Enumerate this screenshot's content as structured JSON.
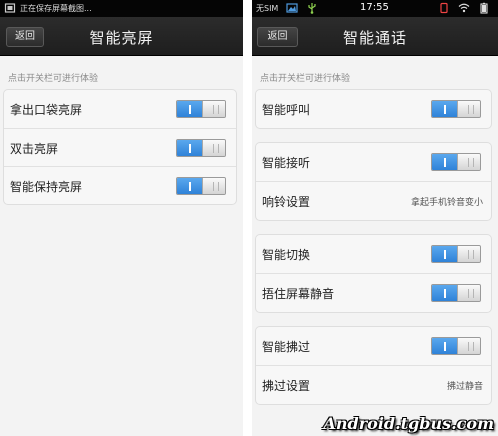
{
  "left": {
    "status": {
      "notification": "正在保存屏幕截图..."
    },
    "header": {
      "back_label": "返回",
      "title": "智能亮屏"
    },
    "hint": "点击开关栏可进行体验",
    "items": [
      {
        "label": "拿出口袋亮屏",
        "enabled": true
      },
      {
        "label": "双击亮屏",
        "enabled": true
      },
      {
        "label": "智能保持亮屏",
        "enabled": true
      }
    ]
  },
  "right": {
    "status": {
      "carrier": "无SIM",
      "time": "17:55"
    },
    "header": {
      "back_label": "返回",
      "title": "智能通话"
    },
    "hint": "点击开关栏可进行体验",
    "groups": [
      {
        "rows": [
          {
            "label": "智能呼叫",
            "enabled": true
          }
        ]
      },
      {
        "rows": [
          {
            "label": "智能接听",
            "enabled": true
          },
          {
            "label": "响铃设置",
            "value": "拿起手机铃音变小"
          }
        ]
      },
      {
        "rows": [
          {
            "label": "智能切换",
            "enabled": true
          },
          {
            "label": "捂住屏幕静音",
            "enabled": true
          }
        ]
      },
      {
        "rows": [
          {
            "label": "智能拂过",
            "enabled": true
          },
          {
            "label": "拂过设置",
            "value": "拂过静音"
          }
        ]
      }
    ]
  },
  "watermark": "Android.tgbus.com",
  "colors": {
    "toggle_on": "#3a8ee3",
    "title_bar": "#262626",
    "status_bar": "#050505",
    "page_bg": "#f3f3f3"
  }
}
